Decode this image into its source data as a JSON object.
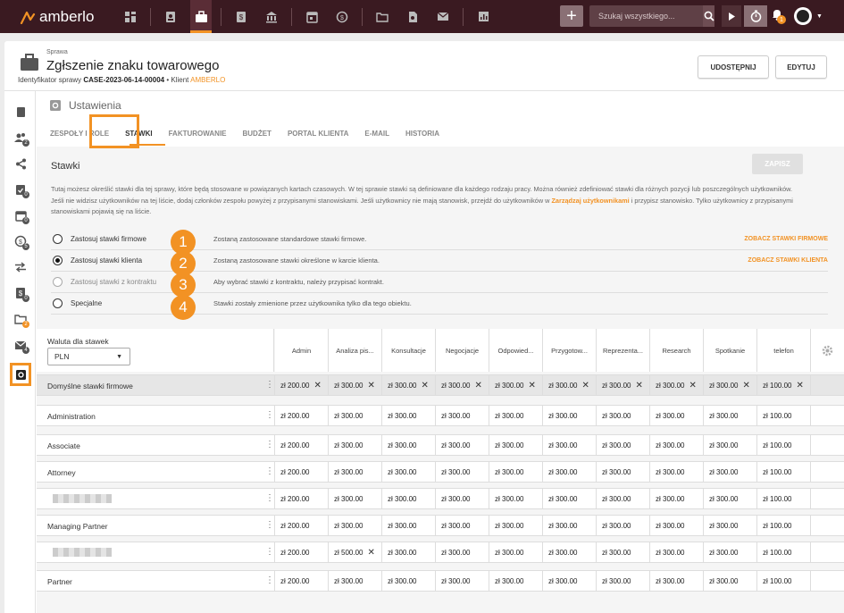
{
  "app": {
    "name": "amberlo"
  },
  "nav_icons": [
    "dashboard-icon",
    "contacts-icon",
    "briefcase-icon",
    "billing-icon",
    "bank-icon",
    "calendar-icon",
    "time-icon",
    "folder-icon",
    "document-search-icon",
    "mail-icon",
    "reports-icon"
  ],
  "search": {
    "placeholder": "Szukaj wszystkiego..."
  },
  "notifications": {
    "count": "1"
  },
  "header": {
    "kicker": "Sprawa",
    "title": "Zgłszenie znaku towarowego",
    "id_label": "Identyfikator sprawy",
    "id_value": "CASE-2023-06-14-00004",
    "client_label": "Klient",
    "client_value": "AMBERLO",
    "share_label": "UDOSTĘPNIJ",
    "edit_label": "EDYTUJ"
  },
  "sidebar_badges": {
    "team": "2",
    "tasks": "0",
    "calendar": "0",
    "time": "5",
    "billing": "0",
    "folder": "2",
    "mail": "4"
  },
  "settings": {
    "title": "Ustawienia",
    "tabs": [
      {
        "label": "ZESPOŁY I ROLE"
      },
      {
        "label": "STAWKI"
      },
      {
        "label": "FAKTUROWANIE"
      },
      {
        "label": "BUDŻET"
      },
      {
        "label": "PORTAL KLIENTA"
      },
      {
        "label": "E-MAIL"
      },
      {
        "label": "HISTORIA"
      }
    ]
  },
  "rates": {
    "title": "Stawki",
    "save_label": "ZAPISZ",
    "info_line1": "Tutaj możesz określić stawki dla tej sprawy, które będą stosowane w powiązanych kartach czasowych. W tej sprawie stawki są definiowane dla każdego rodzaju pracy. Można również zdefiniować stawki dla różnych pozycji lub poszczególnych użytkowników.",
    "info_line2a": "Jeśli nie widzisz użytkowników na tej liście, dodaj członków zespołu powyżej z przypisanymi stanowiskami. Jeśli użytkownicy nie mają stanowisk, przejdź do użytkowników w ",
    "info_link": "Zarządzaj użytkownikami",
    "info_line2b": " i przypisz stanowisko. Tylko użytkownicy z przypisanymi stanowiskami pojawią się na liście.",
    "options": [
      {
        "label": "Zastosuj stawki firmowe",
        "desc": "Zostaną zastosowane standardowe stawki firmowe.",
        "link": "ZOBACZ STAWKI FIRMOWE",
        "num": "1"
      },
      {
        "label": "Zastosuj stawki klienta",
        "desc": "Zostaną zastosowane stawki określone w karcie klienta.",
        "link": "ZOBACZ STAWKI KLIENTA",
        "num": "2"
      },
      {
        "label": "Zastosuj stawki z kontraktu",
        "desc": "Aby wybrać stawki z kontraktu, należy przypisać kontrakt.",
        "link": "",
        "num": "3"
      },
      {
        "label": "Specjalne",
        "desc": "Stawki zostały zmienione przez użytkownika tylko dla tego obiektu.",
        "link": "",
        "num": "4"
      }
    ],
    "currency_label": "Waluta dla stawek",
    "currency_value": "PLN",
    "columns": [
      "Admin",
      "Analiza pis...",
      "Konsultacje",
      "Negocjacje",
      "Odpowied...",
      "Przygotow...",
      "Reprezenta...",
      "Research",
      "Spotkanie",
      "telefon"
    ],
    "rows": [
      {
        "name": "Domyślne stawki firmowe",
        "values": [
          "zł 200.00",
          "zł 300.00",
          "zł 300.00",
          "zł 300.00",
          "zł 300.00",
          "zł 300.00",
          "zł 300.00",
          "zł 300.00",
          "zł 300.00",
          "zł 100.00"
        ]
      },
      {
        "name": "Administration",
        "values": [
          "zł 200.00",
          "zł 300.00",
          "zł 300.00",
          "zł 300.00",
          "zł 300.00",
          "zł 300.00",
          "zł 300.00",
          "zł 300.00",
          "zł 300.00",
          "zł 100.00"
        ]
      },
      {
        "name": "Associate",
        "values": [
          "zł 200.00",
          "zł 300.00",
          "zł 300.00",
          "zł 300.00",
          "zł 300.00",
          "zł 300.00",
          "zł 300.00",
          "zł 300.00",
          "zł 300.00",
          "zł 100.00"
        ]
      },
      {
        "name": "Attorney",
        "values": [
          "zł 200.00",
          "zł 300.00",
          "zł 300.00",
          "zł 300.00",
          "zł 300.00",
          "zł 300.00",
          "zł 300.00",
          "zł 300.00",
          "zł 300.00",
          "zł 100.00"
        ]
      },
      {
        "name": "",
        "values": [
          "zł 200.00",
          "zł 300.00",
          "zł 300.00",
          "zł 300.00",
          "zł 300.00",
          "zł 300.00",
          "zł 300.00",
          "zł 300.00",
          "zł 300.00",
          "zł 100.00"
        ]
      },
      {
        "name": "Managing Partner",
        "values": [
          "zł 200.00",
          "zł 300.00",
          "zł 300.00",
          "zł 300.00",
          "zł 300.00",
          "zł 300.00",
          "zł 300.00",
          "zł 300.00",
          "zł 300.00",
          "zł 100.00"
        ]
      },
      {
        "name": "",
        "values": [
          "zł 200.00",
          "zł 500.00",
          "zł 300.00",
          "zł 300.00",
          "zł 300.00",
          "zł 300.00",
          "zł 300.00",
          "zł 300.00",
          "zł 300.00",
          "zł 100.00"
        ]
      },
      {
        "name": "Partner",
        "values": [
          "zł 200.00",
          "zł 300.00",
          "zł 300.00",
          "zł 300.00",
          "zł 300.00",
          "zł 300.00",
          "zł 300.00",
          "zł 300.00",
          "zł 300.00",
          "zł 100.00"
        ]
      }
    ]
  },
  "colors": {
    "accent": "#f29224",
    "topbar": "#3a1a21"
  }
}
